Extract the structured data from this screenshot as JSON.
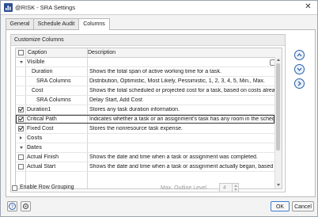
{
  "window": {
    "title": "@RISK - SRA Settings",
    "close_glyph": "✕"
  },
  "tabs": [
    {
      "label": "General"
    },
    {
      "label": "Schedule Audit"
    },
    {
      "label": "Columns"
    }
  ],
  "group": {
    "title": "Customize Columns"
  },
  "grid": {
    "header_caption": "Caption",
    "header_description": "Description",
    "rows": [
      {
        "caption": "Visible",
        "description": ""
      },
      {
        "caption": "Duration",
        "description": "Shows the total span of active working time for a task."
      },
      {
        "caption": "SRA Columns",
        "description": "Distribution, Optimistic, Most Likely, Pessimistic, 1, 2, 3, 4, 5, Min., Max."
      },
      {
        "caption": "Cost",
        "description": "Shows the total scheduled or projected cost for a task, based on costs already inc..."
      },
      {
        "caption": "SRA Columns",
        "description": "Delay Start, Add Cost"
      },
      {
        "caption": "Duration1",
        "description": "Stores any task duration information."
      },
      {
        "caption": "Critical Path",
        "description": "Indicates whether a task or an assignment's task has any room in the schedule to s..."
      },
      {
        "caption": "Fixed Cost",
        "description": "Stores the nonresource task expense."
      },
      {
        "caption": "Costs",
        "description": ""
      },
      {
        "caption": "Dates",
        "description": ""
      },
      {
        "caption": "Actual Finish",
        "description": "Shows the date and time when a task or assignment was completed."
      },
      {
        "caption": "Actual Start",
        "description": "Shows the date and time when a task or assignment actually began, based on pr..."
      }
    ]
  },
  "options": {
    "row_grouping_label": "Enable Row Grouping",
    "outline_level_label": "Max. Outline Level",
    "outline_level_value": "4"
  },
  "buttons": {
    "ok": "OK",
    "cancel": "Cancel"
  },
  "colors": {
    "accent": "#2b5fa8",
    "brand": "#2b4f93"
  }
}
